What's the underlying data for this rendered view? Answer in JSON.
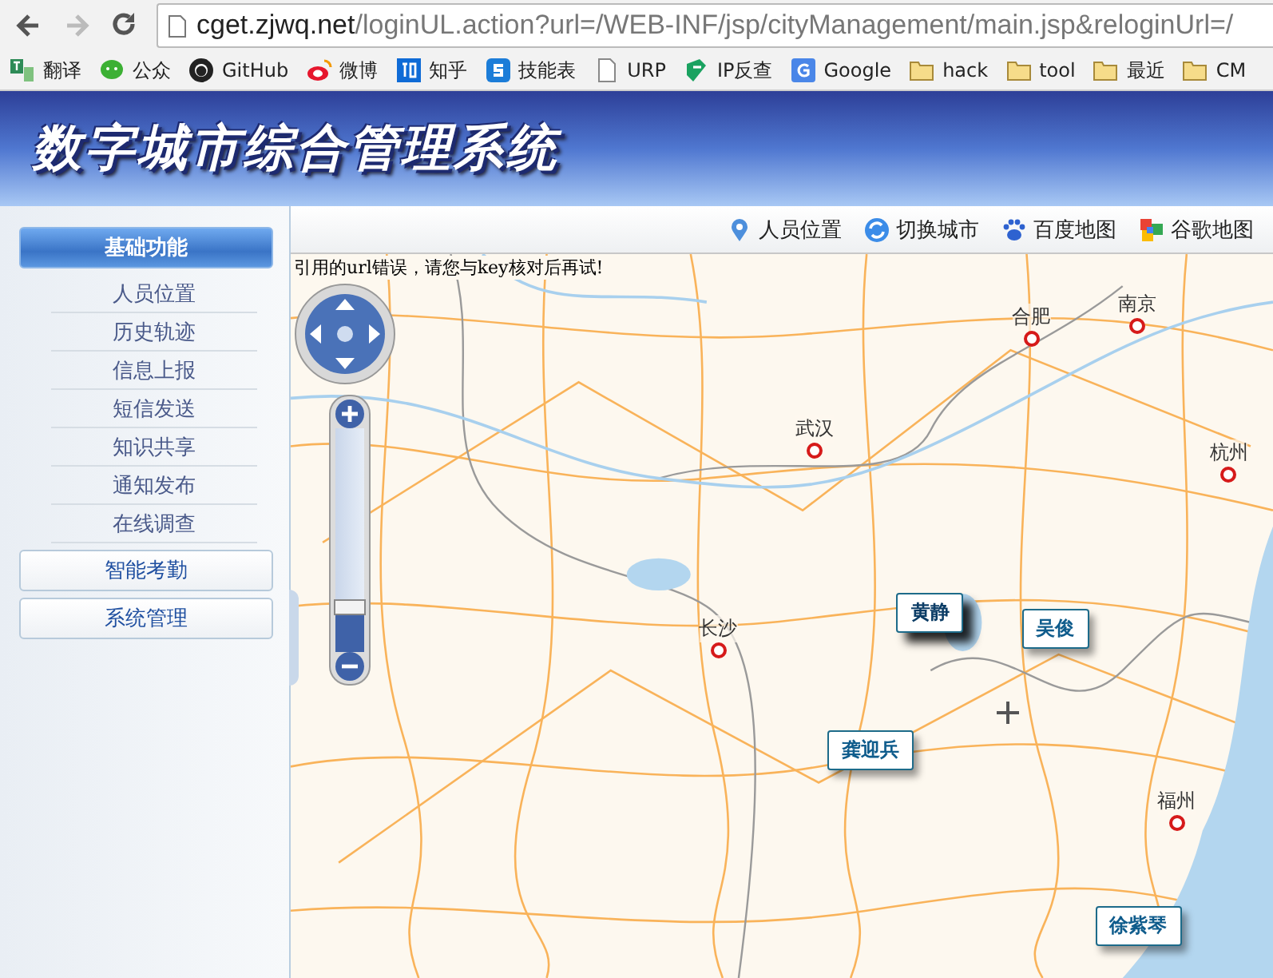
{
  "browser": {
    "nav": [
      {
        "kind": "back",
        "disabled": false
      },
      {
        "kind": "forward",
        "disabled": true
      },
      {
        "kind": "reload",
        "disabled": false
      }
    ],
    "url_host": "cget.zjwq.net",
    "url_path": "/loginUL.action?url=/WEB-INF/jsp/cityManagement/main.jsp&reloginUrl=/",
    "bookmarks": [
      {
        "label": "翻译",
        "kind": "translate"
      },
      {
        "label": "公众",
        "kind": "chat"
      },
      {
        "label": "GitHub",
        "kind": "cat"
      },
      {
        "label": "微博",
        "kind": "eye"
      },
      {
        "label": "知乎",
        "kind": "zhi"
      },
      {
        "label": "技能表",
        "kind": "s"
      },
      {
        "label": "URP",
        "kind": "page"
      },
      {
        "label": "IP反查",
        "kind": "ip"
      },
      {
        "label": "Google",
        "kind": "g"
      },
      {
        "label": "hack",
        "kind": "folder"
      },
      {
        "label": "tool",
        "kind": "folder"
      },
      {
        "label": "最近",
        "kind": "folder"
      },
      {
        "label": "CM",
        "kind": "folder"
      }
    ]
  },
  "header": {
    "title": "数字城市综合管理系统"
  },
  "sidebar": {
    "groups": [
      {
        "label": "基础功能",
        "selected": true,
        "children": [
          {
            "label": "人员位置"
          },
          {
            "label": "历史轨迹"
          },
          {
            "label": "信息上报"
          },
          {
            "label": "短信发送"
          },
          {
            "label": "知识共享"
          },
          {
            "label": "通知发布"
          },
          {
            "label": "在线调查"
          }
        ]
      },
      {
        "label": "智能考勤",
        "selected": false
      },
      {
        "label": "系统管理",
        "selected": false
      }
    ]
  },
  "map_toolbar": [
    {
      "label": "人员位置",
      "kind": "pin"
    },
    {
      "label": "切换城市",
      "kind": "switch"
    },
    {
      "label": "百度地图",
      "kind": "paw"
    },
    {
      "label": "谷歌地图",
      "kind": "cubes"
    }
  ],
  "map": {
    "error": "引用的url错误，请您与key核对后再试!",
    "zoom": {
      "level": 0.2
    },
    "cities": [
      {
        "name": "合肥"
      },
      {
        "name": "南京"
      },
      {
        "name": "武汉"
      },
      {
        "name": "杭州"
      },
      {
        "name": "长沙"
      },
      {
        "name": "福州"
      }
    ],
    "markers": [
      {
        "name": "黄静",
        "selected": true
      },
      {
        "name": "吴俊",
        "selected": false
      },
      {
        "name": "龚迎兵",
        "selected": false
      },
      {
        "name": "徐紫琴",
        "selected": false
      }
    ]
  }
}
